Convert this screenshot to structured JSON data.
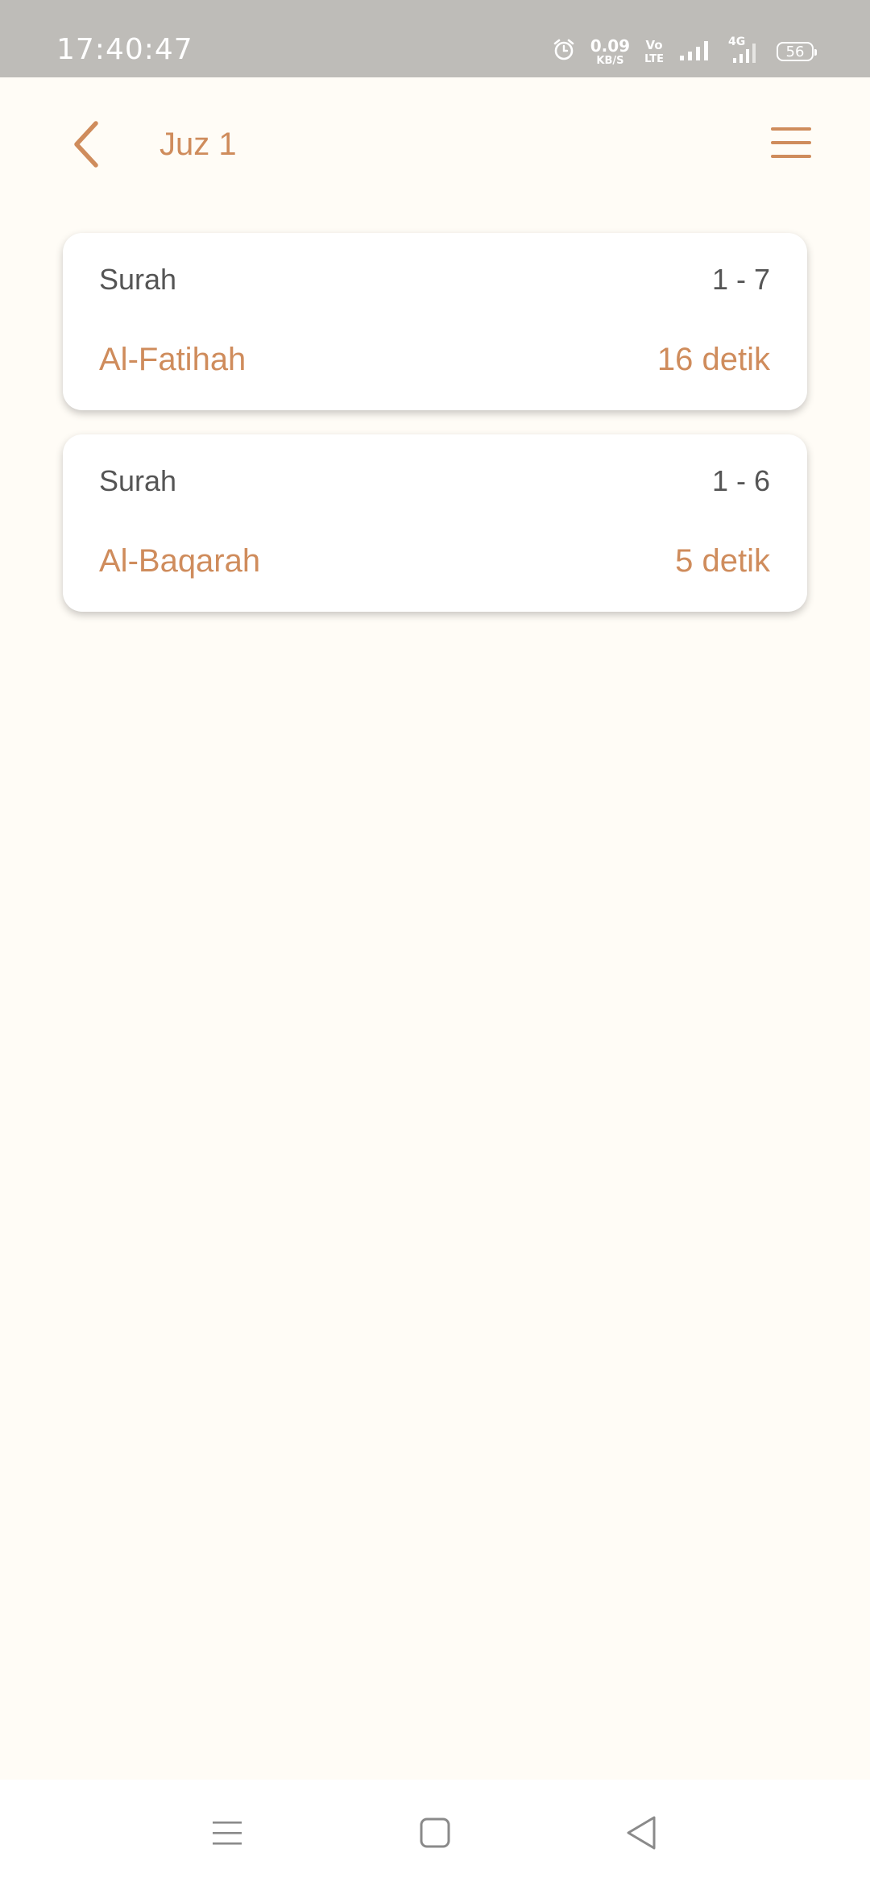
{
  "status_bar": {
    "time": "17:40:47",
    "net_speed_value": "0.09",
    "net_speed_unit": "KB/S",
    "volte_top": "Vo",
    "volte_bottom": "LTE",
    "network_type": "4G",
    "battery_level": "56",
    "icons": [
      "alarm-icon",
      "signal-icon",
      "signal-4g-icon",
      "battery-icon"
    ]
  },
  "header": {
    "title": "Juz 1",
    "back_icon": "chevron-left-icon",
    "menu_icon": "hamburger-menu-icon"
  },
  "surah_list": [
    {
      "label": "Surah",
      "range": "1 - 7",
      "name": "Al-Fatihah",
      "duration": "16 detik"
    },
    {
      "label": "Surah",
      "range": "1 - 6",
      "name": "Al-Baqarah",
      "duration": "5 detik"
    }
  ],
  "nav_bar": {
    "icons": [
      "recents-icon",
      "home-icon",
      "back-triangle-icon"
    ]
  },
  "colors": {
    "accent": "#cf8c5c",
    "background": "#fffcf6",
    "status_bar": "#bebcb8",
    "text_secondary": "#555555"
  }
}
